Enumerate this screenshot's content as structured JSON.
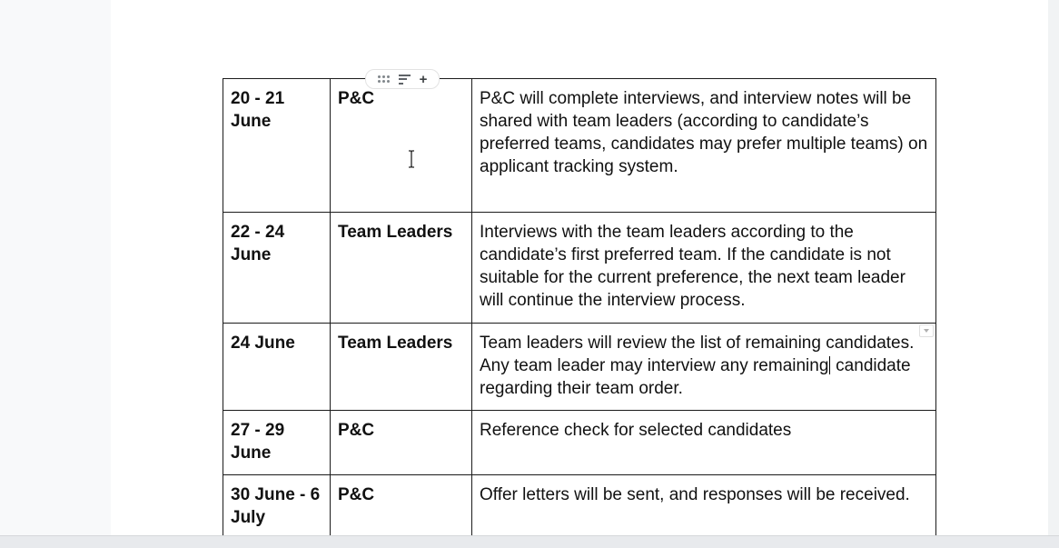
{
  "table": {
    "rows": [
      {
        "date": "20 - 21 June",
        "owner": "P&C",
        "description": "P&C will complete interviews, and interview notes will be shared with team leaders (according to candidate’s preferred teams, candidates may prefer multiple teams) on applicant tracking system."
      },
      {
        "date": "22 - 24 June",
        "owner": "Team Leaders",
        "description": "Interviews with the team leaders according to the candidate’s first preferred team. If the candidate is not suitable for the current preference, the next team leader will continue the interview process."
      },
      {
        "date": "24 June",
        "owner": "Team Leaders",
        "description_before_caret": "Team leaders will review the list of remaining candidates. Any team leader may interview any remaining",
        "description_after_caret": " candidate regarding their team order."
      },
      {
        "date": "27 - 29 June",
        "owner": "P&C",
        "description": "Reference check for selected candidates"
      },
      {
        "date": "30 June - 6 July",
        "owner": "P&C",
        "description": "Offer letters will be sent, and responses will be received."
      }
    ]
  },
  "column_toolbar": {
    "drag_icon": "drag-handle-icon",
    "sort_icon": "sort-icon",
    "add_label": "+"
  }
}
